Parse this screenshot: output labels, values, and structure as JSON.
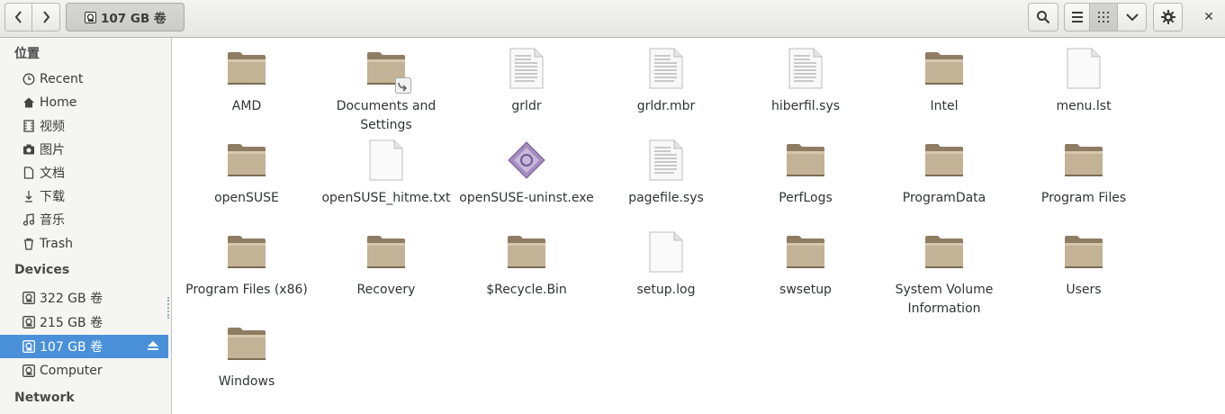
{
  "header": {
    "back_icon": "chevron-left-icon",
    "forward_icon": "chevron-right-icon",
    "path_label": "107 GB 卷",
    "search_icon": "search-icon",
    "list_view_icon": "list-icon",
    "grid_view_icon": "grid-icon",
    "view_menu_icon": "chevron-down-icon",
    "settings_icon": "gear-icon",
    "close_label": "✕"
  },
  "sidebar": {
    "places_heading": "位置",
    "places": [
      {
        "label": "Recent",
        "icon": "clock-icon"
      },
      {
        "label": "Home",
        "icon": "home-icon"
      },
      {
        "label": "视频",
        "icon": "film-icon"
      },
      {
        "label": "图片",
        "icon": "camera-icon"
      },
      {
        "label": "文档",
        "icon": "document-icon"
      },
      {
        "label": "下载",
        "icon": "download-icon"
      },
      {
        "label": "音乐",
        "icon": "music-icon"
      },
      {
        "label": "Trash",
        "icon": "trash-icon"
      }
    ],
    "devices_heading": "Devices",
    "devices": [
      {
        "label": "322 GB 卷",
        "icon": "drive-icon"
      },
      {
        "label": "215 GB 卷",
        "icon": "drive-icon"
      },
      {
        "label": "107 GB 卷",
        "icon": "drive-icon",
        "selected": true
      },
      {
        "label": "Computer",
        "icon": "computer-icon"
      }
    ],
    "network_heading": "Network"
  },
  "files": [
    {
      "name": "AMD",
      "type": "folder"
    },
    {
      "name": "Documents and Settings",
      "type": "folder-link"
    },
    {
      "name": "grldr",
      "type": "text"
    },
    {
      "name": "grldr.mbr",
      "type": "text"
    },
    {
      "name": "hiberfil.sys",
      "type": "text"
    },
    {
      "name": "Intel",
      "type": "folder"
    },
    {
      "name": "menu.lst",
      "type": "blank"
    },
    {
      "name": "openSUSE",
      "type": "folder"
    },
    {
      "name": "openSUSE_hitme.txt",
      "type": "blank"
    },
    {
      "name": "openSUSE-uninst.exe",
      "type": "exe"
    },
    {
      "name": "pagefile.sys",
      "type": "text"
    },
    {
      "name": "PerfLogs",
      "type": "folder"
    },
    {
      "name": "ProgramData",
      "type": "folder"
    },
    {
      "name": "Program Files",
      "type": "folder"
    },
    {
      "name": "Program Files (x86)",
      "type": "folder"
    },
    {
      "name": "Recovery",
      "type": "folder"
    },
    {
      "name": "$Recycle.Bin",
      "type": "folder"
    },
    {
      "name": "setup.log",
      "type": "blank"
    },
    {
      "name": "swsetup",
      "type": "folder"
    },
    {
      "name": "System Volume Information",
      "type": "folder"
    },
    {
      "name": "Users",
      "type": "folder"
    },
    {
      "name": "Windows",
      "type": "folder"
    }
  ]
}
